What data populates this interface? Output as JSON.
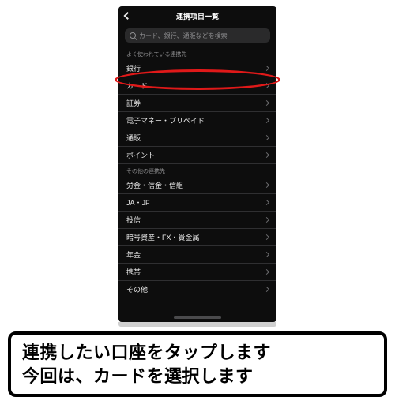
{
  "header": {
    "title": "連携項目一覧"
  },
  "search": {
    "placeholder": "カード、銀行、通販などを検索"
  },
  "sections": {
    "popular": {
      "label": "よく使われている連携先",
      "items": [
        {
          "label": "銀行"
        },
        {
          "label": "カード"
        },
        {
          "label": "証券"
        },
        {
          "label": "電子マネー・プリペイド"
        },
        {
          "label": "通販"
        },
        {
          "label": "ポイント"
        }
      ]
    },
    "other": {
      "label": "その他の連携先",
      "items": [
        {
          "label": "労金・信金・信組"
        },
        {
          "label": "JA・JF"
        },
        {
          "label": "投信"
        },
        {
          "label": "暗号資産・FX・貴金属"
        },
        {
          "label": "年金"
        },
        {
          "label": "携帯"
        },
        {
          "label": "その他"
        }
      ]
    }
  },
  "annotation": {
    "highlight_item": "カード",
    "circle_color": "#e01919"
  },
  "caption": {
    "line1": "連携したい口座をタップします",
    "line2": "今回は、カードを選択します"
  }
}
